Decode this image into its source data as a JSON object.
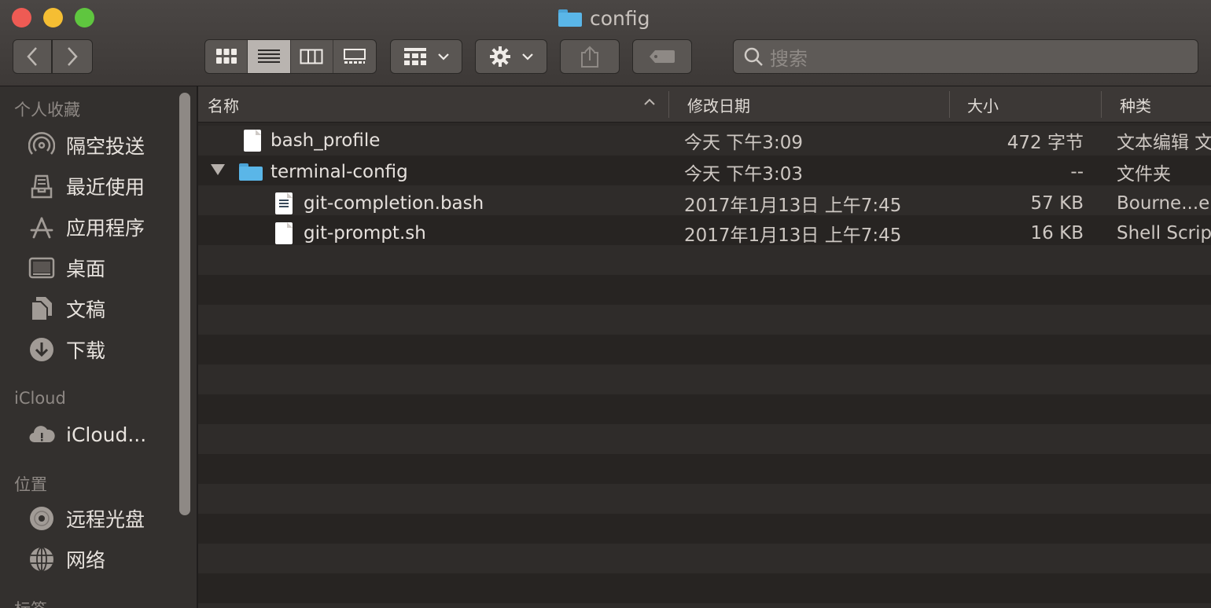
{
  "window": {
    "title": "config"
  },
  "toolbar": {
    "search_placeholder": "搜索"
  },
  "sidebar": {
    "sections": [
      {
        "heading": "个人收藏",
        "items": [
          {
            "label": "隔空投送",
            "icon": "airdrop-icon"
          },
          {
            "label": "最近使用",
            "icon": "recents-icon"
          },
          {
            "label": "应用程序",
            "icon": "applications-icon"
          },
          {
            "label": "桌面",
            "icon": "desktop-icon"
          },
          {
            "label": "文稿",
            "icon": "documents-icon"
          },
          {
            "label": "下载",
            "icon": "downloads-icon"
          }
        ]
      },
      {
        "heading": "iCloud",
        "items": [
          {
            "label": "iCloud...",
            "icon": "icloud-icon"
          }
        ]
      },
      {
        "heading": "位置",
        "items": [
          {
            "label": "远程光盘",
            "icon": "remote-disc-icon"
          },
          {
            "label": "网络",
            "icon": "network-icon"
          }
        ]
      },
      {
        "heading": "标签",
        "items": []
      }
    ]
  },
  "columns": {
    "name": "名称",
    "modified": "修改日期",
    "size": "大小",
    "kind": "种类"
  },
  "files": [
    {
      "name": "bash_profile",
      "modified": "今天 下午3:09",
      "size": "472 字节",
      "kind": "文本编辑 文",
      "type": "document"
    },
    {
      "name": "terminal-config",
      "modified": "今天 下午3:03",
      "size": "--",
      "kind": "文件夹",
      "type": "folder-expanded"
    },
    {
      "name": "git-completion.bash",
      "modified": "2017年1月13日 上午7:45",
      "size": "57 KB",
      "kind": "Bourne...el",
      "type": "script"
    },
    {
      "name": "git-prompt.sh",
      "modified": "2017年1月13日 上午7:45",
      "size": "16 KB",
      "kind": "Shell Scrip",
      "type": "document"
    }
  ]
}
